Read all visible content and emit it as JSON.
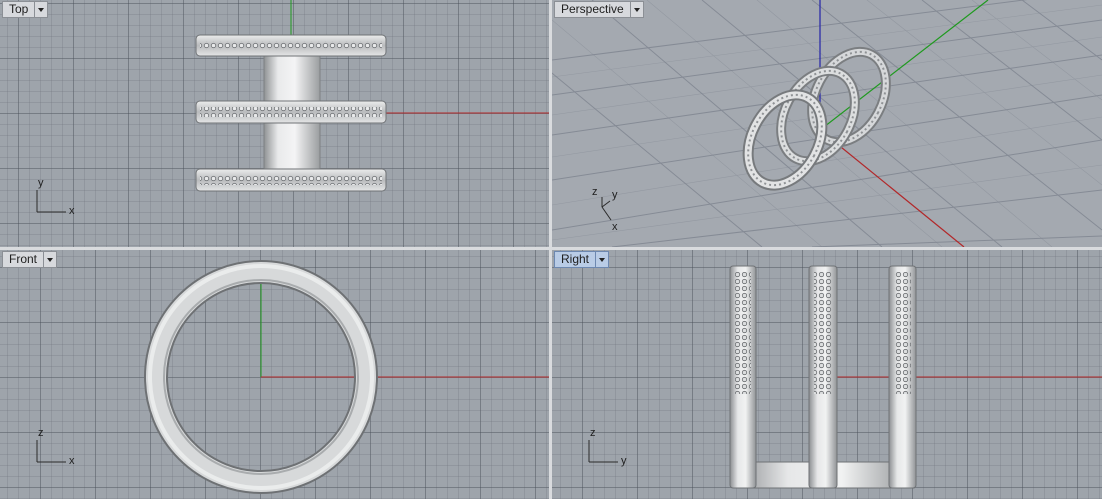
{
  "viewports": {
    "top": {
      "label": "Top",
      "axes": {
        "vertical": "y",
        "horizontal": "x"
      },
      "active": false
    },
    "perspective": {
      "label": "Perspective",
      "axes": {
        "a": "z",
        "b": "y",
        "c": "x"
      },
      "active": false
    },
    "front": {
      "label": "Front",
      "axes": {
        "vertical": "z",
        "horizontal": "x"
      },
      "active": false
    },
    "right": {
      "label": "Right",
      "axes": {
        "vertical": "z",
        "horizontal": "y"
      },
      "active": true
    }
  },
  "colors": {
    "x_axis": "#b2282a",
    "y_axis": "#1f9a1f",
    "z_axis": "#2323a8",
    "active_label": "#b9cce6",
    "metal": "#c8cacc"
  },
  "icons": {
    "dropdown": "chevron-down-icon"
  }
}
